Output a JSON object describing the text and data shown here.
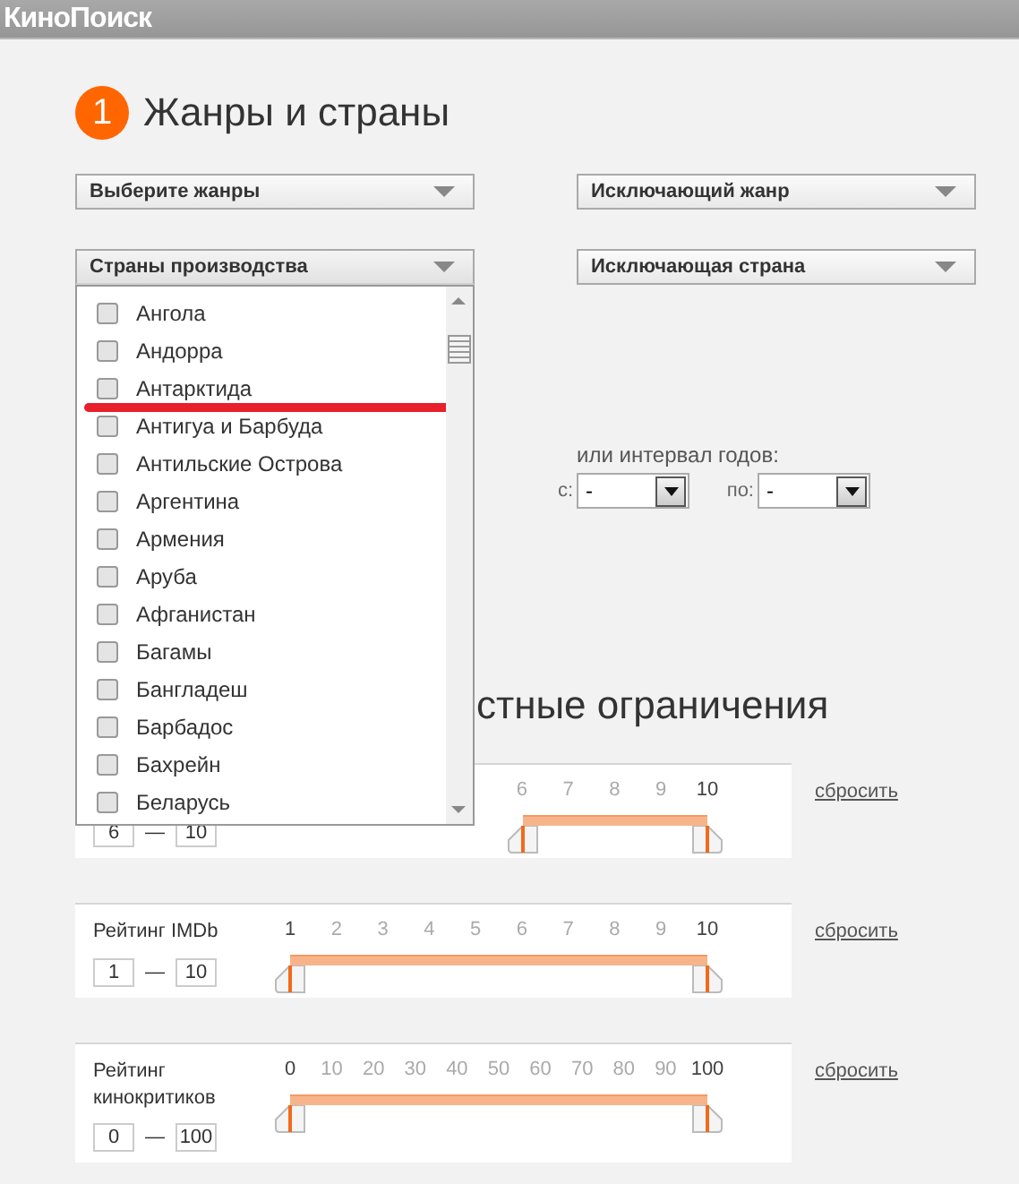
{
  "logo": "КиноПоиск",
  "section": {
    "number": "1",
    "title": "Жанры и страны"
  },
  "filters": [
    {
      "label": "Выберите жанры",
      "expanded": false
    },
    {
      "label": "Исключающий жанр",
      "expanded": false
    },
    {
      "label": "Страны производства",
      "expanded": true,
      "options": [
        {
          "label": "Ангола",
          "checked": false,
          "marked": false
        },
        {
          "label": "Андорра",
          "checked": false,
          "marked": false
        },
        {
          "label": "Антарктида",
          "checked": false,
          "marked": true
        },
        {
          "label": "Антигуа и Барбуда",
          "checked": false,
          "marked": false
        },
        {
          "label": "Антильские Острова",
          "checked": false,
          "marked": false
        },
        {
          "label": "Аргентина",
          "checked": false,
          "marked": false
        },
        {
          "label": "Армения",
          "checked": false,
          "marked": false
        },
        {
          "label": "Аруба",
          "checked": false,
          "marked": false
        },
        {
          "label": "Афганистан",
          "checked": false,
          "marked": false
        },
        {
          "label": "Багамы",
          "checked": false,
          "marked": false
        },
        {
          "label": "Бангладеш",
          "checked": false,
          "marked": false
        },
        {
          "label": "Барбадос",
          "checked": false,
          "marked": false
        },
        {
          "label": "Бахрейн",
          "checked": false,
          "marked": false
        },
        {
          "label": "Беларусь",
          "checked": false,
          "marked": false
        }
      ]
    },
    {
      "label": "Исключающая страна",
      "expanded": false
    }
  ],
  "years": {
    "title": "или интервал годов:",
    "from_label": "с:",
    "from_value": "-",
    "to_label": "по:",
    "to_value": "-"
  },
  "section2_heading": "стные ограничения",
  "sliders": [
    {
      "ticks": [
        {
          "label": "6",
          "strong": false
        },
        {
          "label": "7",
          "strong": false
        },
        {
          "label": "8",
          "strong": false
        },
        {
          "label": "9",
          "strong": false
        },
        {
          "label": "10",
          "strong": true
        }
      ],
      "handles": [
        {
          "level": 0.556
        },
        {
          "level": 1
        }
      ],
      "min": "6",
      "separator": "—",
      "max": "10",
      "reset": "сбросить"
    },
    {
      "label": "Рейтинг IMDb",
      "ticks": [
        {
          "label": "1",
          "strong": true
        },
        {
          "label": "2",
          "strong": false
        },
        {
          "label": "3",
          "strong": false
        },
        {
          "label": "4",
          "strong": false
        },
        {
          "label": "5",
          "strong": false
        },
        {
          "label": "6",
          "strong": false
        },
        {
          "label": "7",
          "strong": false
        },
        {
          "label": "8",
          "strong": false
        },
        {
          "label": "9",
          "strong": false
        },
        {
          "label": "10",
          "strong": true
        }
      ],
      "handles": [
        {
          "level": 0
        },
        {
          "level": 1
        }
      ],
      "min": "1",
      "separator": "—",
      "max": "10",
      "reset": "сбросить"
    },
    {
      "label": "Рейтинг кинокритиков",
      "ticks": [
        {
          "label": "0",
          "strong": true
        },
        {
          "label": "10",
          "strong": false
        },
        {
          "label": "20",
          "strong": false
        },
        {
          "label": "30",
          "strong": false
        },
        {
          "label": "40",
          "strong": false
        },
        {
          "label": "50",
          "strong": false
        },
        {
          "label": "60",
          "strong": false
        },
        {
          "label": "70",
          "strong": false
        },
        {
          "label": "80",
          "strong": false
        },
        {
          "label": "90",
          "strong": false
        },
        {
          "label": "100",
          "strong": true
        }
      ],
      "handles": [
        {
          "level": 0
        },
        {
          "level": 1
        }
      ],
      "min": "0",
      "separator": "—",
      "max": "100",
      "reset": "сбросить"
    }
  ]
}
